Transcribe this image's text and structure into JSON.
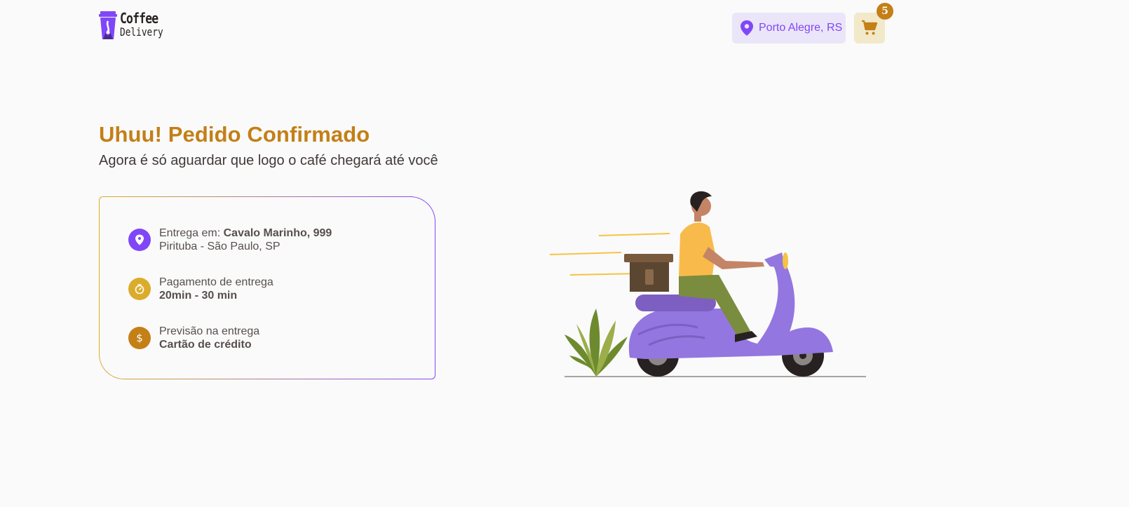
{
  "header": {
    "logo": {
      "line1": "Coffee",
      "line2": "Delivery"
    },
    "location": {
      "label": "Porto Alegre, RS",
      "icon": "map-pin-icon"
    },
    "cart": {
      "icon": "shopping-cart-icon",
      "count": "5"
    }
  },
  "main": {
    "title": "Uhuu! Pedido Confirmado",
    "subtitle": "Agora é só aguardar que logo o café chegará até você"
  },
  "order_info": [
    {
      "icon": "map-pin-icon",
      "color": "#8047F8",
      "label": "Entrega em: ",
      "value_bold": "Cavalo Marinho, 999",
      "line2": "Pirituba - São Paulo, SP"
    },
    {
      "icon": "timer-icon",
      "color": "#DBAC2C",
      "line1": "Pagamento de entrega",
      "line2_bold": "20min - 30 min"
    },
    {
      "icon": "currency-dollar-icon",
      "color": "#C47F17",
      "line1": "Previsão na entrega",
      "line2_bold": "Cartão de crédito"
    }
  ],
  "colors": {
    "brand_purple": "#8047F8",
    "brand_yellow": "#DBAC2C",
    "brand_yellow_dark": "#C47F17",
    "background": "#FAFAFA"
  }
}
